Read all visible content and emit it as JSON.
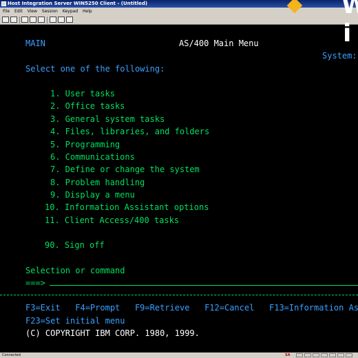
{
  "window": {
    "title": "Host Integration Server WIN5250 Client - (Untitled)"
  },
  "menubar": {
    "items": [
      "File",
      "Edit",
      "View",
      "Session",
      "Keypad",
      "Help"
    ]
  },
  "toolbar": {
    "icons": [
      "connect-icon",
      "save-icon",
      "properties-icon",
      "keyboard-icon",
      "macro-icon",
      "copy-icon",
      "paste-icon",
      "print-icon"
    ]
  },
  "screen": {
    "screen_id": "MAIN",
    "title": "AS/400 Main Menu",
    "system_label": "System:",
    "instruction": "Select one of the following:",
    "options": [
      "1. User tasks",
      "2. Office tasks",
      "3. General system tasks",
      "4. Files, libraries, and folders",
      "5. Programming",
      "6. Communications",
      "7. Define or change the system",
      "8. Problem handling",
      "9. Display a menu",
      "10. Information Assistant options",
      "11. Client Access/400 tasks"
    ],
    "signoff": "90. Sign off",
    "command_label": "Selection or command",
    "prompt": "===>",
    "command_value": "",
    "fkeys_line1": "F3=Exit   F4=Prompt   F9=Retrieve   F12=Cancel   F13=Information As",
    "fkeys_line2": "F23=Set initial menu",
    "copyright": "(C) COPYRIGHT IBM CORP. 1980, 1999."
  },
  "overlay": {
    "letter_top": "W",
    "letter_bottom": "i"
  },
  "statusbar": {
    "status": "Connected",
    "indicator": "SA"
  },
  "colors": {
    "terminal_bg": "#000000",
    "terminal_green": "#00e060",
    "terminal_white": "#ffffff",
    "terminal_blue": "#3aa0ff",
    "titlebar": "#0a246a",
    "accent_diamond": "#f6b31c"
  }
}
